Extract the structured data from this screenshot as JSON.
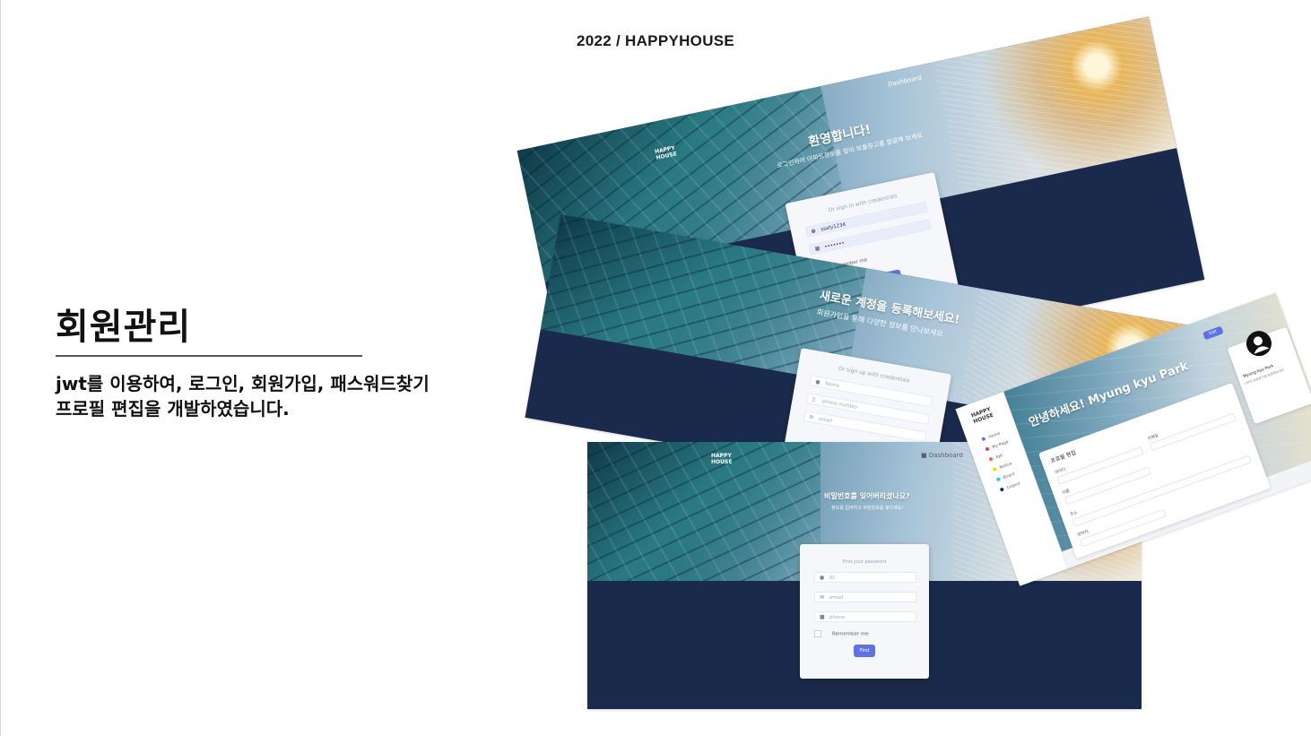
{
  "header": "2022 / HAPPYHOUSE",
  "title": "회원관리",
  "description": {
    "line1": "jwt를 이용하여, 로그인, 회원가입, 패스워드찾기",
    "line2": "프로필 편집을 개발하였습니다."
  },
  "screens": {
    "login": {
      "nav": [
        "Dashboard"
      ],
      "logo": "HAPPY\nHOUSE",
      "title": "환영합니다!",
      "subtitle": "로그인하여 아파트정보를 찾아 보물창고를 발굴해 보세요",
      "caption": "Or sign in with credentials",
      "id_value": "ssafy1234",
      "password_value": "•••••••",
      "remember": "Remember me",
      "button": "Sign In"
    },
    "signup": {
      "title": "새로운 계정을 등록해보세요!",
      "subtitle": "회원가입을 통해 다양한 정보를 만나보세요.",
      "caption": "Or sign up with credentials",
      "fields": [
        "Name",
        "phone number",
        "email"
      ]
    },
    "find_password": {
      "nav": "Dashboard",
      "logo": "HAPPY\nHOUSE",
      "title": "비밀번호를 잊어버리셨나요?",
      "subtitle": "정보를 입력하고 비밀번호를 찾으세요!",
      "caption": "Find your password",
      "fields": [
        "ID",
        "email",
        "phone"
      ],
      "remember": "Remember me",
      "button": "Find"
    },
    "profile": {
      "greeting": "안녕하세요! Myung kyu Park",
      "edit_button": "Edit",
      "logo": "HAPPY\nHOUSE",
      "sidebar": [
        "Home",
        "My Page",
        "Apt",
        "Notice",
        "Board",
        "Logout"
      ],
      "section_title": "프로필 편집",
      "name": "Myung kyu Park",
      "name_sub": "나만의 보물창고를 발굴해보세요",
      "field_labels": [
        "아이디",
        "이메일",
        "이름",
        "주소",
        "연락처"
      ]
    }
  }
}
